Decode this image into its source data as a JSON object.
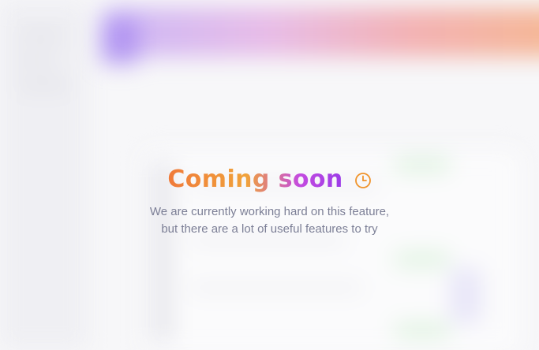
{
  "coming_soon": {
    "title": "Coming soon",
    "icon": "clock-icon",
    "message_line1": "We are currently working hard on this feature,",
    "message_line2": "but there are a lot of useful features to try"
  },
  "colors": {
    "title_gradient_start": "#f07a3a",
    "title_gradient_mid": "#f0a23a",
    "title_gradient_end": "#9a3be8",
    "clock_color": "#f0932a",
    "subtitle_color": "#7c7f96"
  }
}
